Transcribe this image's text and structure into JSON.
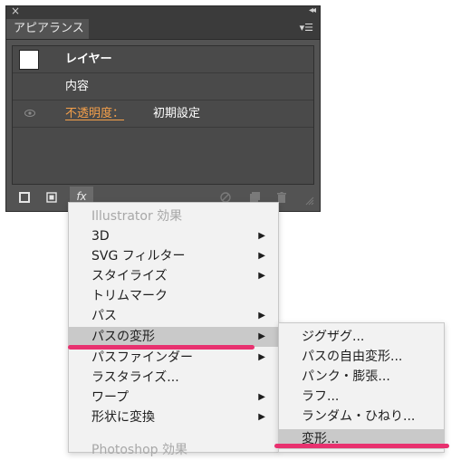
{
  "panel": {
    "tab_label": "アピアランス",
    "rows": {
      "layer": "レイヤー",
      "content": "内容",
      "opacity_label": "不透明度：",
      "opacity_value": "初期設定"
    },
    "fx_label": "fx"
  },
  "menu1": {
    "header": "Illustrator 効果",
    "items": [
      {
        "label": "3D"
      },
      {
        "label": "SVG フィルター"
      },
      {
        "label": "スタイライズ"
      },
      {
        "label": "トリムマーク"
      },
      {
        "label": "パス"
      },
      {
        "label": "パスの変形"
      },
      {
        "label": "パスファインダー"
      },
      {
        "label": "ラスタライズ..."
      },
      {
        "label": "ワープ"
      },
      {
        "label": "形状に変換"
      }
    ],
    "footer": "Photoshop 効果"
  },
  "menu2": {
    "items": [
      {
        "label": "ジグザグ..."
      },
      {
        "label": "パスの自由変形..."
      },
      {
        "label": "パンク・膨張..."
      },
      {
        "label": "ラフ..."
      },
      {
        "label": "ランダム・ひねり..."
      },
      {
        "label": "変形..."
      }
    ]
  },
  "colors": {
    "highlight_underline": "#e8316f",
    "opacity_label": "#f5a04a",
    "panel_bg": "#535353"
  }
}
